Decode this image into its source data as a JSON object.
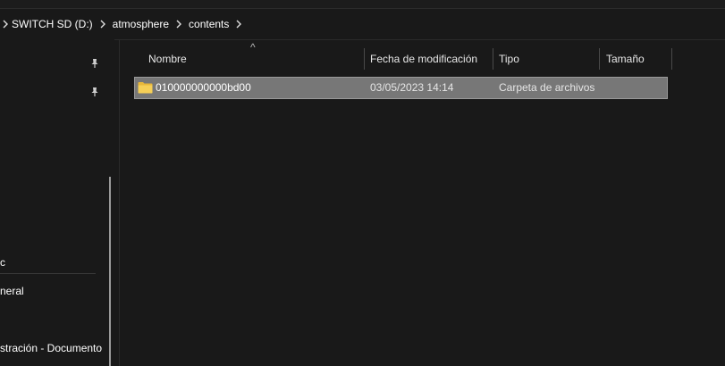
{
  "breadcrumb": {
    "items": [
      "SWITCH SD (D:)",
      "atmosphere",
      "contents"
    ]
  },
  "nav": {
    "pinned_icon": "pin-icon",
    "items": [
      "c",
      "neral",
      "stración - Documento"
    ]
  },
  "columns": {
    "name": "Nombre",
    "date": "Fecha de modificación",
    "type": "Tipo",
    "size": "Tamaño",
    "sort_glyph": "^"
  },
  "files": [
    {
      "name": "010000000000bd00",
      "date": "03/05/2023 14:14",
      "type": "Carpeta de archivos",
      "size": "",
      "icon": "folder-icon",
      "selected": true
    }
  ],
  "colors": {
    "background": "#191919",
    "selection": "#777777",
    "folder": "#f2c94c"
  }
}
